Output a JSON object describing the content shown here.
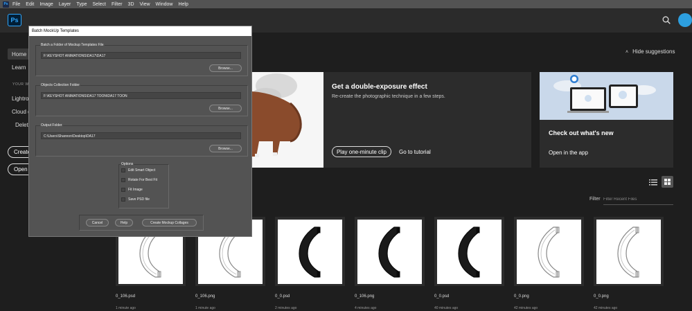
{
  "menubar": {
    "app_badge": "Ps",
    "items": [
      "File",
      "Edit",
      "Image",
      "Layer",
      "Type",
      "Select",
      "Filter",
      "3D",
      "View",
      "Window",
      "Help"
    ]
  },
  "appbar": {
    "logo": "Ps",
    "search_icon": "search-icon",
    "avatar_color": "#2d9fe0"
  },
  "nav": {
    "home": "Home",
    "learn": "Learn",
    "section_header": "YOUR W",
    "lightroom": "Lightroo",
    "cloud": "Cloud d",
    "deleted": "Delete",
    "create": "Create",
    "open": "Open"
  },
  "hide_suggestions": "Hide suggestions",
  "card_double_exposure": {
    "title": "Get a double-exposure effect",
    "description": "Re-create the photographic technique in a few steps.",
    "play_button": "Play one-minute clip",
    "tutorial_link": "Go to tutorial"
  },
  "card_whats_new": {
    "title": "Check out what's new",
    "link": "Open in the app"
  },
  "filter": {
    "label": "Filter",
    "placeholder": "Filter Recent Files"
  },
  "recent_files": [
    {
      "name": "0_106.psd",
      "time": "1 minute ago",
      "style": "outline"
    },
    {
      "name": "0_106.png",
      "time": "1 minute ago",
      "style": "outline"
    },
    {
      "name": "0_0.psd",
      "time": "2 minutes ago",
      "style": "dark"
    },
    {
      "name": "0_106.png",
      "time": "4 minutes ago",
      "style": "dark"
    },
    {
      "name": "0_0.psd",
      "time": "40 minutes ago",
      "style": "dark"
    },
    {
      "name": "0_0.png",
      "time": "42 minutes ago",
      "style": "outline"
    },
    {
      "name": "0_0.png",
      "time": "42 minutes ago",
      "style": "outline"
    }
  ],
  "dialog": {
    "title": "Batch MockUp Templates",
    "group1": {
      "label": "Batch a Folder of Mockup Templates File",
      "path": "F:\\KEYSHOT ANIMATIONS\\DA17\\DA17",
      "browse": "Browse..."
    },
    "group2": {
      "label": "Objects Collection Folder",
      "path": "F:\\KEYSHOT ANIMATIONS\\DA17 TOON\\DA17 TOON",
      "browse": "Browse..."
    },
    "group3": {
      "label": "Output Folder",
      "path": "C:\\Users\\Shannon\\Desktop\\DA17",
      "browse": "Browse..."
    },
    "options": {
      "label": "Options",
      "items": [
        "Edit Smart Object",
        "Rotate For Best Fit",
        "Fit Image",
        "Save PSD file"
      ]
    },
    "cancel": "Cancel",
    "help": "Help",
    "create": "Create Mockup Collages"
  }
}
